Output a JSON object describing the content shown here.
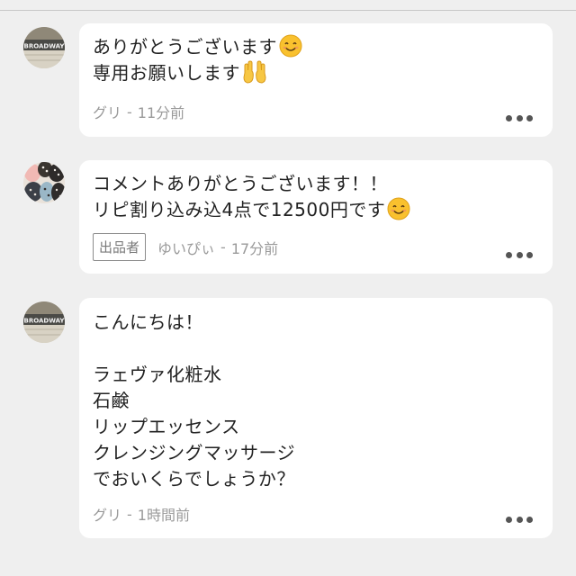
{
  "comments": [
    {
      "line1": "ありがとうございます",
      "line1_emoji": "smiling-face-emoji",
      "line2": "専用お願いします",
      "line2_emoji": "raised-hands-emoji",
      "author": "グリ",
      "time": "11分前",
      "avatar": "broadway-sign-avatar"
    },
    {
      "line1": "コメントありがとうございます！！",
      "line2": "リピ割り込み込4点で12500円です",
      "line2_emoji": "smiling-face-emoji",
      "badge": "出品者",
      "author": "ゆいぴぃ",
      "time": "17分前",
      "avatar": "polka-dot-avatar"
    },
    {
      "text": "こんにちは！\n\nラェヴァ化粧水\n石鹸\nリップエッセンス\nクレンジングマッサージ\nでおいくらでしょうか？",
      "author": "グリ",
      "time": "1時間前",
      "avatar": "broadway-sign-avatar"
    }
  ],
  "meta_separator": "-",
  "avatar_sign_text": "BROADWAY",
  "more_icon": "more-options-icon",
  "colors": {
    "background": "#efefef",
    "bubble": "#ffffff",
    "text": "#222222",
    "meta": "#9a9a9a"
  }
}
